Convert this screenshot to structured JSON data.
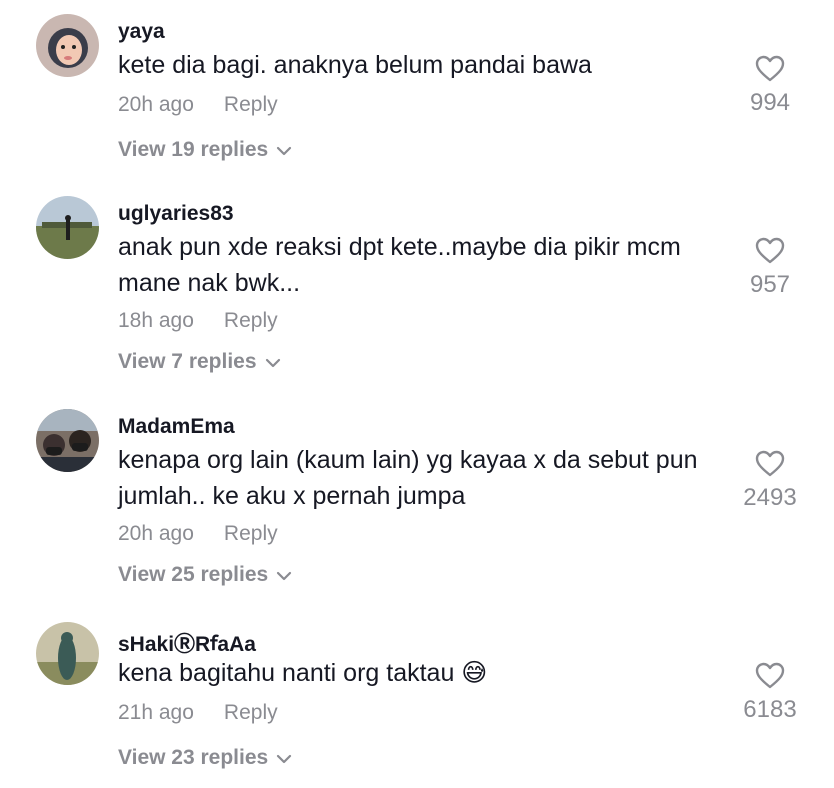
{
  "comments": [
    {
      "username": "yaya",
      "text": "kete dia bagi. anaknya belum pandai bawa",
      "time": "20h ago",
      "reply_label": "Reply",
      "view_replies": "View 19 replies",
      "likes": "994"
    },
    {
      "username": "uglyaries83",
      "text": "anak pun xde reaksi dpt kete..maybe dia pikir mcm mane nak bwk...",
      "time": "18h ago",
      "reply_label": "Reply",
      "view_replies": "View 7 replies",
      "likes": "957"
    },
    {
      "username": "MadamEma",
      "text": "kenapa org lain (kaum lain) yg kayaa x da sebut pun jumlah.. ke aku x pernah jumpa",
      "time": "20h ago",
      "reply_label": "Reply",
      "view_replies": "View 25 replies",
      "likes": "2493"
    },
    {
      "username": "sHakiⓇRꬵaAa",
      "text": "kena bagitahu nanti org taktau 😅",
      "time": "21h ago",
      "reply_label": "Reply",
      "view_replies": "View 23 replies",
      "likes": "6183"
    }
  ],
  "icons": {
    "like": "heart-outline-icon",
    "expand": "chevron-down-icon"
  },
  "colors": {
    "text": "#161823",
    "secondary": "#8a8b91",
    "background": "#ffffff"
  }
}
